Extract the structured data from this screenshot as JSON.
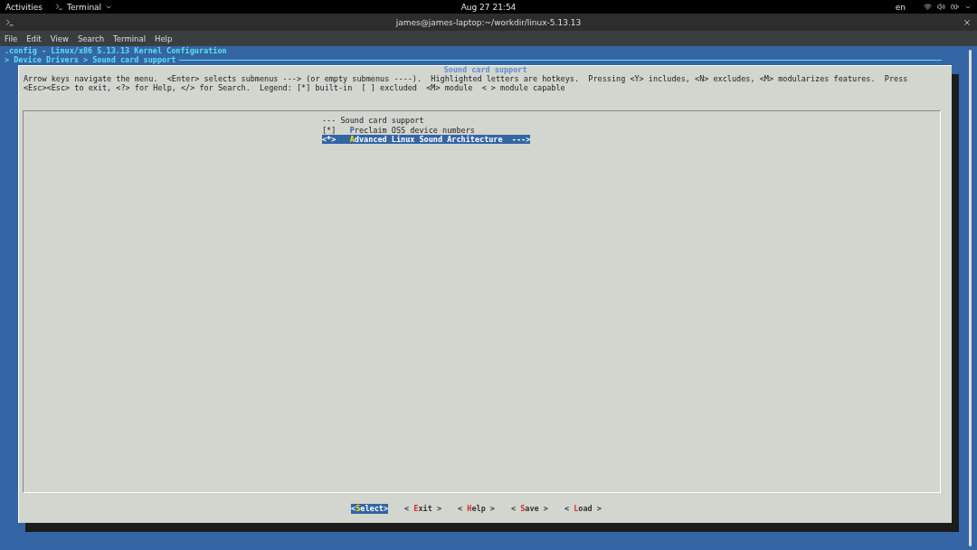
{
  "top_bar": {
    "activities": "Activities",
    "app_menu": "Terminal",
    "clock": "Aug 27  21:54",
    "language": "en"
  },
  "window": {
    "title": "james@james-laptop:~/workdir/linux-5.13.13"
  },
  "menu": [
    "File",
    "Edit",
    "View",
    "Search",
    "Terminal",
    "Help"
  ],
  "header": {
    "config": ".config - Linux/x86 5.13.13 Kernel Configuration",
    "breadcrumb": "> Device Drivers > Sound card support"
  },
  "dialog": {
    "title": "Sound card support",
    "help": [
      "Arrow keys navigate the menu.  <Enter> selects submenus ---> (or empty submenus ----).  Highlighted letters are hotkeys.  Pressing <Y> includes, <N> excludes, <M> modularizes features.  Press",
      "<Esc><Esc> to exit, <?> for Help, </> for Search.  Legend: [*] built-in  [ ] excluded  <M> module  < > module capable"
    ],
    "items": [
      {
        "kind": "heading",
        "text": "--- Sound card support"
      },
      {
        "kind": "option",
        "prefix": "[*]",
        "hotkey": "P",
        "rest": "reclaim OSS device numbers",
        "selected": false
      },
      {
        "kind": "option",
        "prefix": "<*>",
        "hotkey": "A",
        "rest": "dvanced Linux Sound Architecture",
        "suffix": "  --->",
        "selected": true
      }
    ],
    "buttons": [
      {
        "before": "<",
        "hotkey": "S",
        "after": "elect>",
        "selected": true
      },
      {
        "before": "< ",
        "hotkey": "E",
        "after": "xit >",
        "selected": false
      },
      {
        "before": "< ",
        "hotkey": "H",
        "after": "elp >",
        "selected": false
      },
      {
        "before": "< ",
        "hotkey": "S",
        "after": "ave >",
        "selected": false
      },
      {
        "before": "< ",
        "hotkey": "L",
        "after": "oad >",
        "selected": false
      }
    ]
  }
}
